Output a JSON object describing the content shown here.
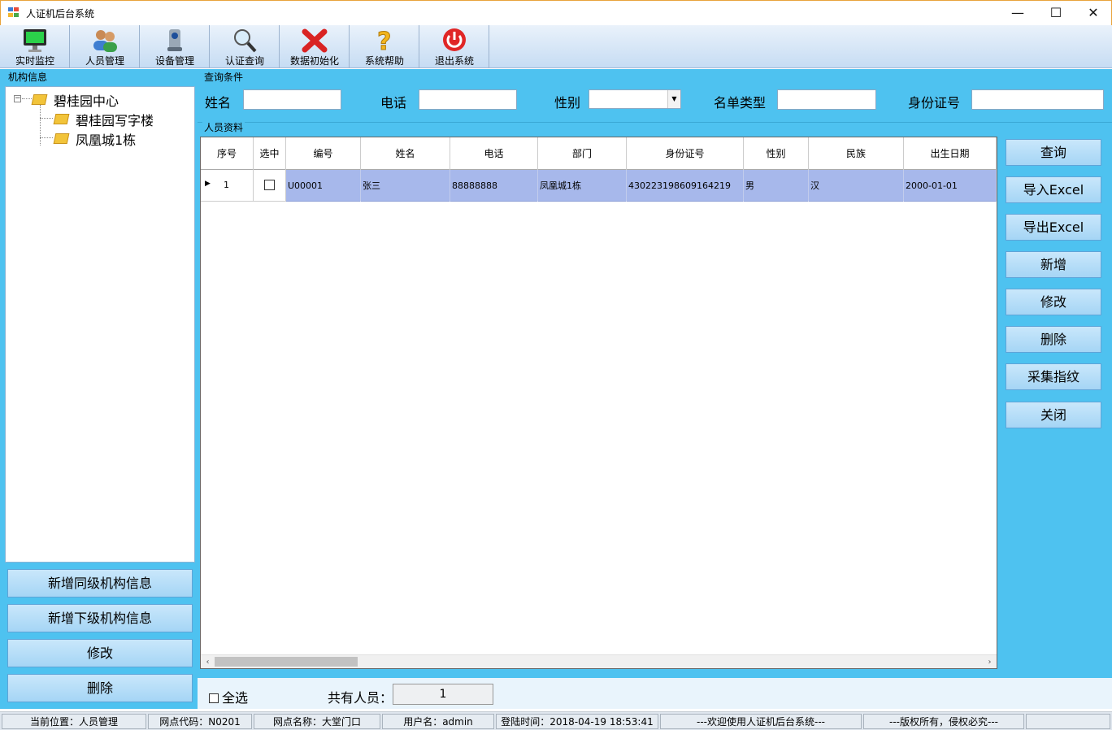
{
  "window": {
    "title": "人证机后台系统",
    "controls": [
      "—",
      "☐",
      "✕"
    ]
  },
  "toolbar": [
    {
      "label": "实时监控",
      "icon": "monitor-icon"
    },
    {
      "label": "人员管理",
      "icon": "users-icon"
    },
    {
      "label": "设备管理",
      "icon": "device-icon"
    },
    {
      "label": "认证查询",
      "icon": "magnifier-icon"
    },
    {
      "label": "数据初始化",
      "icon": "red-x-icon"
    },
    {
      "label": "系统帮助",
      "icon": "question-icon"
    },
    {
      "label": "退出系统",
      "icon": "power-icon"
    }
  ],
  "org_panel": {
    "title": "机构信息",
    "tree": {
      "root": "碧桂园中心",
      "expander": "−",
      "children": [
        "碧桂园写字楼",
        "凤凰城1栋"
      ]
    },
    "buttons": [
      "新增同级机构信息",
      "新增下级机构信息",
      "修改",
      "删除"
    ]
  },
  "query": {
    "title": "查询条件",
    "fields": {
      "name_label": "姓名",
      "name_value": "",
      "phone_label": "电话",
      "phone_value": "",
      "gender_label": "性别",
      "gender_value": "",
      "list_type_label": "名单类型",
      "list_type_value": "",
      "id_label": "身份证号",
      "id_value": ""
    }
  },
  "people": {
    "title": "人员资料",
    "columns": [
      "序号",
      "选中",
      "编号",
      "姓名",
      "电话",
      "部门",
      "身份证号",
      "性别",
      "民族",
      "出生日期"
    ],
    "rows": [
      {
        "seq": "1",
        "selected": false,
        "code": "U00001",
        "name": "张三",
        "phone": "88888888",
        "dept": "凤凰城1栋",
        "id": "430223198609164219",
        "gender": "男",
        "ethnic": "汉",
        "birth": "2000-01-01"
      }
    ]
  },
  "actions": [
    "查询",
    "导入Excel",
    "导出Excel",
    "新增",
    "修改",
    "删除",
    "采集指纹",
    "关闭"
  ],
  "footer": {
    "select_all": "全选",
    "total_label": "共有人员：",
    "total_value": "1"
  },
  "status": [
    "当前位置：人员管理",
    "网点代码：N0201",
    "网点名称：大堂门口",
    "用户名：admin",
    "登陆时间：2018-04-19 18:53:41",
    "---欢迎使用人证机后台系统---",
    "---版权所有，侵权必究---"
  ],
  "colors": {
    "panel": "#4ec2f0",
    "selected_row": "#a7b8eb",
    "button": "#b6dcf7"
  }
}
